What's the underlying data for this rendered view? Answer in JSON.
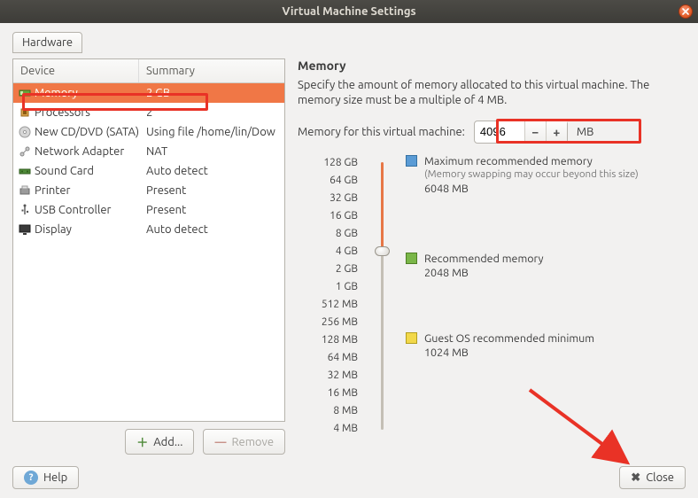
{
  "window": {
    "title": "Virtual Machine Settings"
  },
  "tabs": {
    "hardware": "Hardware"
  },
  "device_table": {
    "col_device": "Device",
    "col_summary": "Summary",
    "rows": [
      {
        "icon": "memory-icon",
        "device": "Memory",
        "summary": "2 GB",
        "selected": true
      },
      {
        "icon": "cpu-icon",
        "device": "Processors",
        "summary": "2",
        "selected": false
      },
      {
        "icon": "disc-icon",
        "device": "New CD/DVD (SATA)",
        "summary": "Using file /home/lin/Dow",
        "selected": false
      },
      {
        "icon": "network-icon",
        "device": "Network Adapter",
        "summary": "NAT",
        "selected": false
      },
      {
        "icon": "sound-icon",
        "device": "Sound Card",
        "summary": "Auto detect",
        "selected": false
      },
      {
        "icon": "printer-icon",
        "device": "Printer",
        "summary": "Present",
        "selected": false
      },
      {
        "icon": "usb-icon",
        "device": "USB Controller",
        "summary": "Present",
        "selected": false
      },
      {
        "icon": "display-icon",
        "device": "Display",
        "summary": "Auto detect",
        "selected": false
      }
    ],
    "add_label": "Add...",
    "remove_label": "Remove"
  },
  "memory_panel": {
    "heading": "Memory",
    "description": "Specify the amount of memory allocated to this virtual machine. The memory size must be a multiple of 4 MB.",
    "input_label": "Memory for this virtual machine:",
    "value": "4096",
    "unit": "MB",
    "ticks": [
      "128 GB",
      "64 GB",
      "32 GB",
      "16 GB",
      "8 GB",
      "4 GB",
      "2 GB",
      "1 GB",
      "512 MB",
      "256 MB",
      "128 MB",
      "64 MB",
      "32 MB",
      "16 MB",
      "8 MB",
      "4 MB"
    ],
    "slider_thumb_tick_label": "4 GB",
    "markers": {
      "max": {
        "title": "Maximum recommended memory",
        "note": "(Memory swapping may occur beyond this size)",
        "value": "6048 MB"
      },
      "rec": {
        "title": "Recommended memory",
        "value": "2048 MB"
      },
      "min": {
        "title": "Guest OS recommended minimum",
        "value": "1024 MB"
      }
    }
  },
  "footer": {
    "help": "Help",
    "close": "Close"
  },
  "annotations": {
    "highlight_rows": [
      "Memory"
    ],
    "highlight_input": true,
    "arrow_to": "close-button"
  }
}
